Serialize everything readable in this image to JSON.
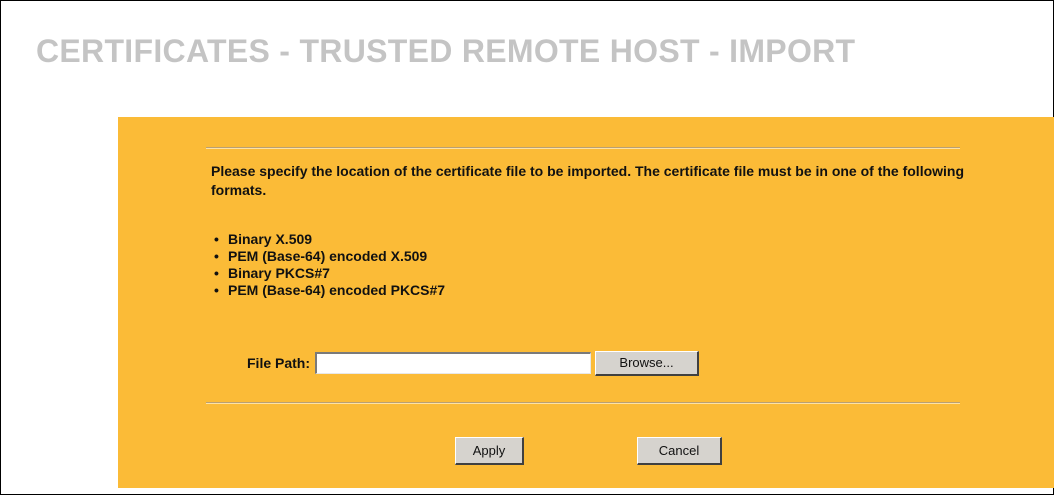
{
  "page": {
    "title": "CERTIFICATES - TRUSTED REMOTE HOST - IMPORT"
  },
  "form": {
    "instructions": "Please specify the location of the certificate file to be imported. The certificate file must be in one of the following formats.",
    "formats": [
      "Binary X.509",
      "PEM (Base-64) encoded X.509",
      "Binary PKCS#7",
      "PEM (Base-64) encoded PKCS#7"
    ],
    "file_path": {
      "label": "File Path:",
      "value": ""
    },
    "browse_label": "Browse...",
    "apply_label": "Apply",
    "cancel_label": "Cancel"
  },
  "colors": {
    "panel_background": "#fbbb37",
    "title_text": "#c4c4c4",
    "button_face": "#d6d3ce"
  }
}
